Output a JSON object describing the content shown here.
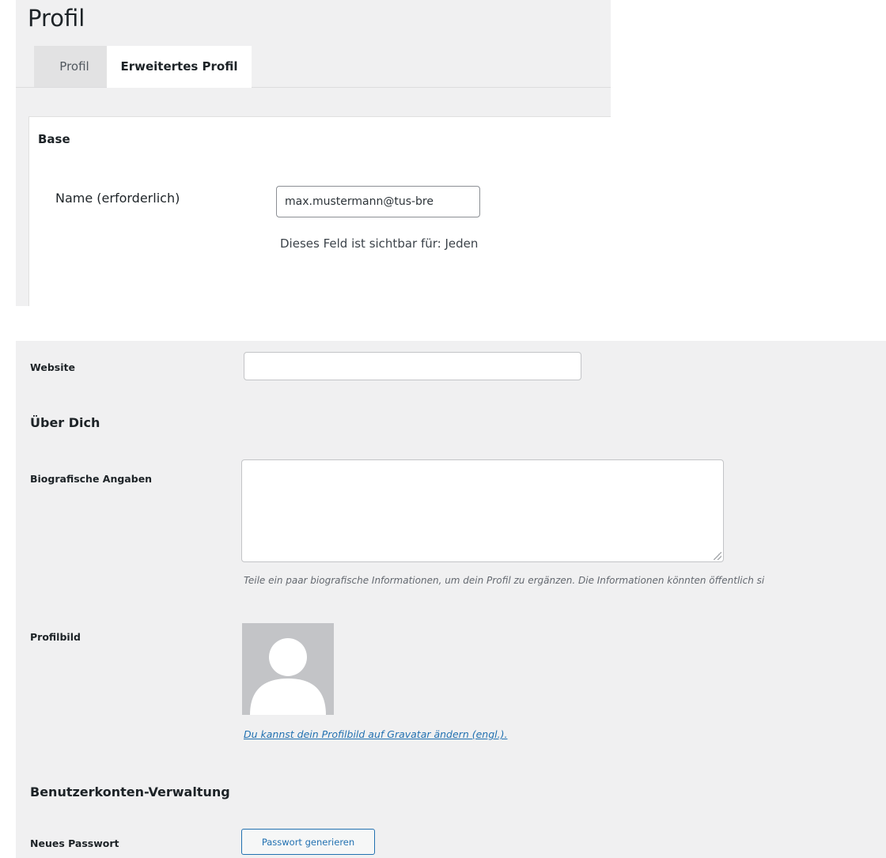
{
  "profile_page": {
    "title": "Profil",
    "tabs": [
      {
        "label": "Profil",
        "active": false
      },
      {
        "label": "Erweitertes Profil",
        "active": true
      }
    ],
    "section_heading": "Base",
    "name_field": {
      "label": "Name (erforderlich)",
      "value": "max.mustermann@tus-bre"
    },
    "visibility_note": "Dieses Feld ist sichtbar für: Jeden"
  },
  "user_profile": {
    "website": {
      "label": "Website",
      "value": ""
    },
    "about_heading": "Über Dich",
    "bio": {
      "label": "Biografische Angaben",
      "value": "",
      "hint": "Teile ein paar biografische Informationen, um dein Profil zu ergänzen. Die Informationen könnten öffentlich si"
    },
    "avatar": {
      "label": "Profilbild",
      "link_text": "Du kannst dein Profilbild auf Gravatar ändern (engl.)."
    },
    "account_heading": "Benutzerkonten-Verwaltung",
    "new_password": {
      "label": "Neues Passwort",
      "button_label": "Passwort generieren"
    }
  },
  "colors": {
    "panel_bg": "#f0f0f1",
    "card_bg": "#ffffff",
    "link": "#2271b1",
    "avatar_bg": "#c3c4c7"
  },
  "icons": {
    "avatar_placeholder": "person-silhouette-icon",
    "textarea_grip": "resize-grip-icon"
  }
}
